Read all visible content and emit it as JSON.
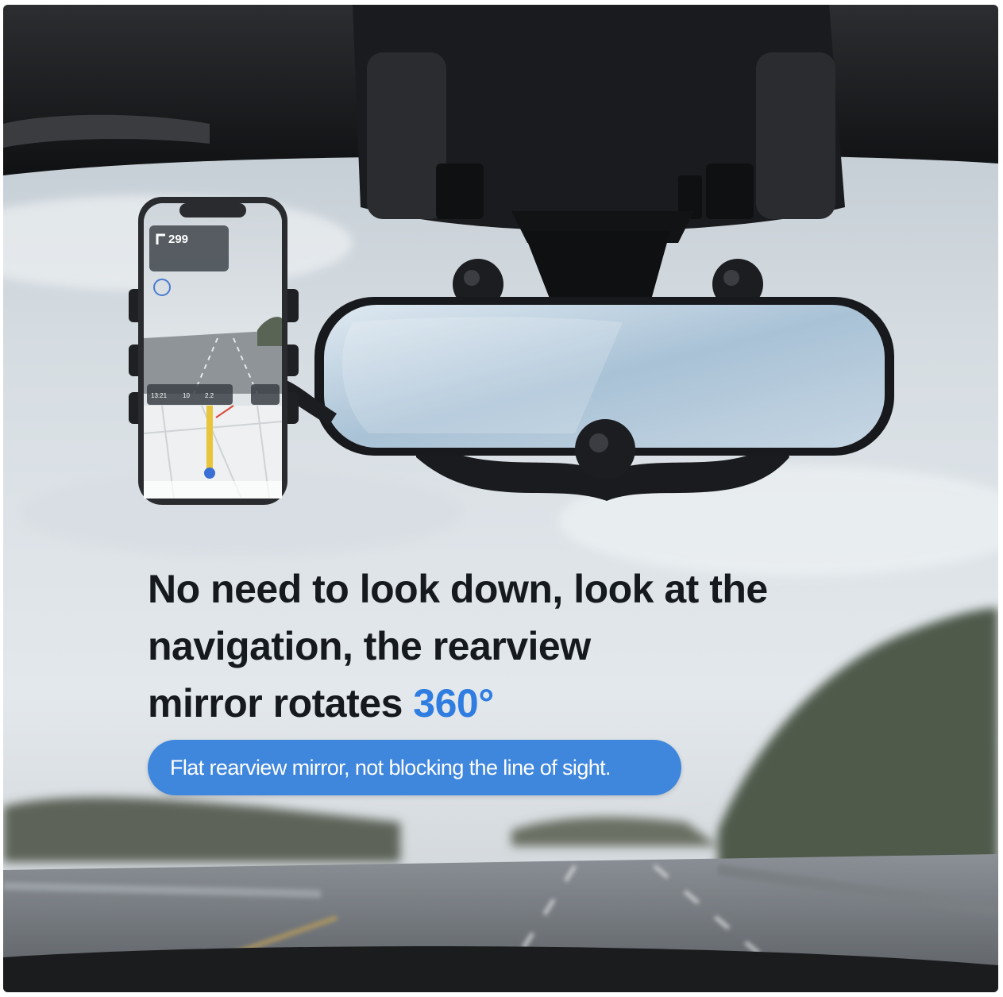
{
  "headline": {
    "line1": "No need to look down, look at the",
    "line2": "navigation, the rearview",
    "line3_prefix": "mirror rotates",
    "line3_accent": "360°"
  },
  "pill_text": "Flat rearview mirror, not blocking the line of sight.",
  "phone_screen": {
    "distance": "299",
    "stat_time": "13:21",
    "stat_a": "10",
    "stat_b": "2.2"
  },
  "colors": {
    "accent": "#2f7de0",
    "pill": "#3f86dd",
    "headline": "#16191d"
  }
}
